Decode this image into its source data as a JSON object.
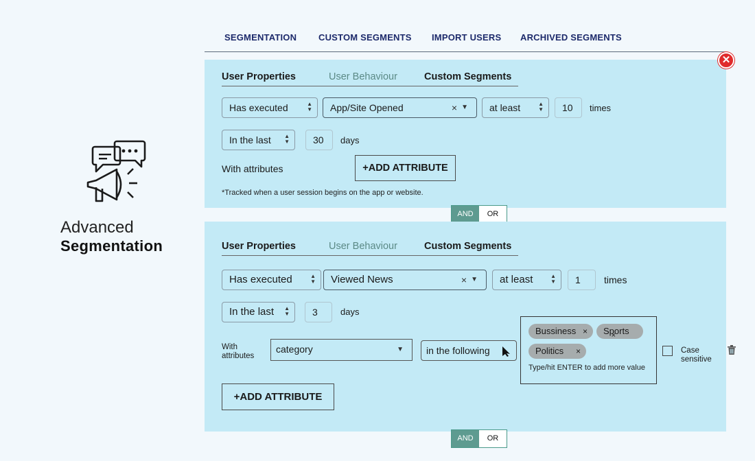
{
  "brand": {
    "line1": "Advanced",
    "line2": "Segmentation",
    "icon": "megaphone-chat-icon"
  },
  "nav": {
    "tabs": [
      "SEGMENTATION",
      "CUSTOM SEGMENTS",
      "IMPORT USERS",
      "ARCHIVED SEGMENTS"
    ],
    "close_icon": "close-icon",
    "close_glyph": "✕"
  },
  "colors": {
    "card_bg": "#c3eaf6",
    "page_bg": "#f2f8fc",
    "nav_text": "#1d2a6b",
    "active_subtab": "#5b8a86",
    "and_bg": "#5e9b90",
    "close_bg": "#e02b2b"
  },
  "card1": {
    "subtabs": [
      "User Properties",
      "User  Behaviour",
      "Custom Segments"
    ],
    "active_subtab": "User  Behaviour",
    "action": "Has executed",
    "event": "App/Site Opened",
    "condition": "at least",
    "count": "10",
    "count_unit": "times",
    "period": "In the last",
    "period_value": "30",
    "period_unit": "days",
    "with_attributes": "With attributes",
    "add_attribute": "+ADD ATTRIBUTE",
    "note": "*Tracked when a user session begins on the app or website."
  },
  "join1": {
    "and": "AND",
    "or": "OR"
  },
  "card2": {
    "subtabs": [
      "User Properties",
      "User Behaviour",
      "Custom Segments"
    ],
    "active_subtab": "User Behaviour",
    "action": "Has executed",
    "event": "Viewed News",
    "condition": "at least",
    "count": "1",
    "count_unit": "times",
    "period": "In the last",
    "period_value": "3",
    "period_unit": "days",
    "with_attributes_1": "With",
    "with_attributes_2": "attributes",
    "attribute": "category",
    "operator": "in the following",
    "values": [
      "Bussiness",
      "Sports",
      "Politics"
    ],
    "values_hint": "Type/hit ENTER to add more value",
    "case_sensitive_1": "Case",
    "case_sensitive_2": "sensitive",
    "add_attribute": "+ADD ATTRIBUTE",
    "delete_icon": "trash-icon"
  },
  "join2": {
    "and": "AND",
    "or": "OR"
  },
  "glyphs": {
    "clear": "×",
    "dropdown": "▼",
    "sort_up": "▲",
    "sort_down": "▼"
  }
}
